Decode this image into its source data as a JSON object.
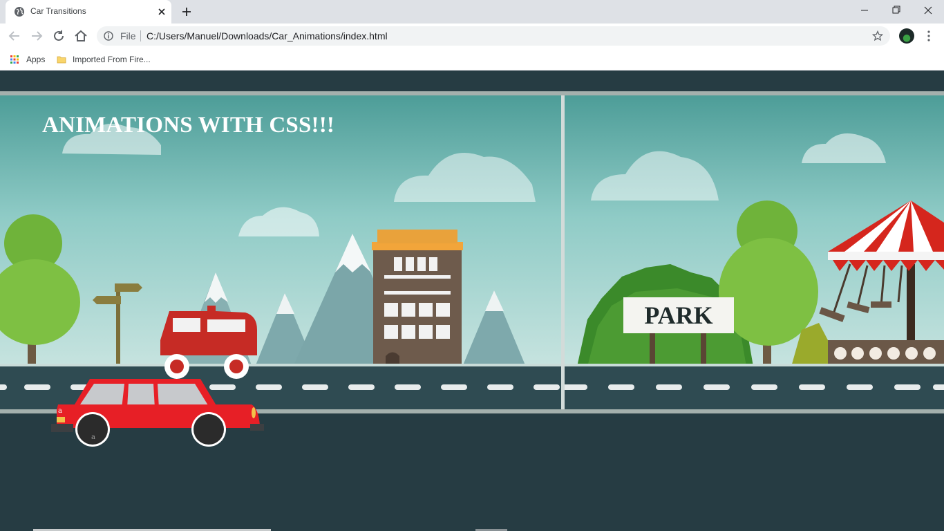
{
  "browser": {
    "tab_title": "Car Transitions",
    "address_prefix": "File",
    "url": "C:/Users/Manuel/Downloads/Car_Animations/index.html",
    "bookmarks": [
      {
        "label": "Apps",
        "icon": "apps-grid-icon"
      },
      {
        "label": "Imported From Fire...",
        "icon": "folder-icon"
      }
    ]
  },
  "page": {
    "title": "ANIMATIONS WITH CSS!!!",
    "park_sign": "PARK",
    "car_marks": [
      "a",
      "a"
    ]
  },
  "colors": {
    "page_background": "#263c43",
    "sky": "#8fcbc6",
    "road": "#2f4b52",
    "car_body": "#e71f26",
    "title_text": "#ffffff"
  }
}
